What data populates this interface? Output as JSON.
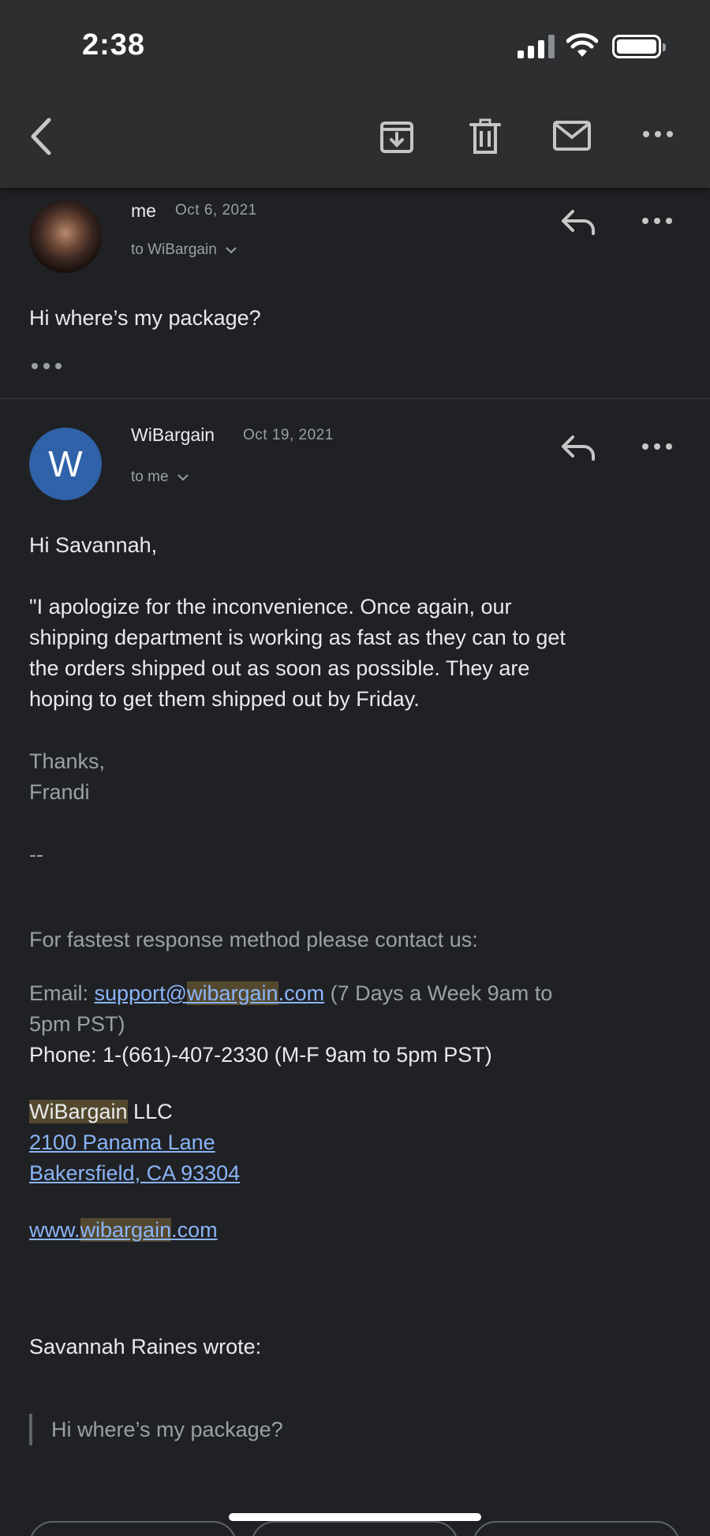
{
  "status_bar": {
    "time": "2:38"
  },
  "toolbar": {
    "back_icon": "chevron-left-icon",
    "archive_icon": "archive-icon",
    "delete_icon": "trash-icon",
    "mark_unread_icon": "mail-icon",
    "more_icon": "more-horizontal-icon"
  },
  "messages": [
    {
      "sender": "me",
      "date": "Oct 6, 2021",
      "recipient": "to WiBargain",
      "body": "Hi where’s my package?",
      "avatar": "profile-photo"
    },
    {
      "sender": "WiBargain",
      "date": "Oct 19, 2021",
      "recipient": "to me",
      "avatar_letter": "W",
      "avatar_color": "#2f62a8",
      "greeting": "Hi Savannah,",
      "paragraph_lines": [
        "\"I apologize for the inconvenience. Once again, our",
        "shipping department is working as fast as they can to get",
        "the orders shipped out as soon as possible. They are",
        "hoping to get them shipped out by Friday."
      ],
      "sign_off": "Thanks,",
      "signature_name": "Frandi",
      "separator": "--",
      "contact_intro": "For fastest response method please contact us:",
      "email_label": "Email: ",
      "email_link_pre": "support@",
      "email_link_hl": "wibargain",
      "email_link_post": ".com",
      "email_hours_1": " (7 Days a Week 9am to",
      "email_hours_2": "5pm PST)",
      "phone_line": "Phone: 1-(661)-407-2330 (M-F 9am to 5pm PST)",
      "company_hl": "WiBargain",
      "company_rest": " LLC",
      "address_1": "2100 Panama Lane",
      "address_2": "Bakersfield, CA 93304",
      "website_pre": "www.",
      "website_hl": "wibargain",
      "website_post": ".com",
      "quote_header": "Savannah Raines wrote:",
      "quoted_text": "Hi where’s my package?"
    }
  ],
  "colors": {
    "background": "#202124",
    "toolbar": "#2d2e30",
    "link": "#8ab4f8",
    "highlight": "#54492f"
  }
}
